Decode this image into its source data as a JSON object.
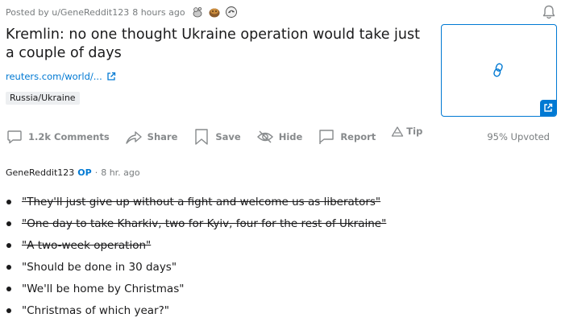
{
  "post": {
    "posted_by": "Posted by u/GeneReddit123",
    "time": "8 hours ago",
    "awards": [
      "wholesome-seal-award",
      "helpful-award",
      "take-my-energy-award"
    ],
    "title": "Kremlin: no one thought Ukraine operation would take just a couple of days",
    "link": "reuters.com/world/...",
    "flair": "Russia/Ukraine"
  },
  "actions": {
    "comments": "1.2k Comments",
    "share": "Share",
    "save": "Save",
    "hide": "Hide",
    "report": "Report",
    "tip": "Tip"
  },
  "upvoted": "95% Upvoted",
  "comment": {
    "author": "GeneReddit123",
    "op": "OP",
    "separator": "·",
    "time": "8 hr. ago",
    "items": [
      {
        "text": "\"They'll just give up without a fight and welcome us as liberators\"",
        "struck": true
      },
      {
        "text": "\"One day to take Kharkiv, two for Kyiv, four for the rest of Ukraine\"",
        "struck": true
      },
      {
        "text": "\"A two-week operation\"",
        "struck": true
      },
      {
        "text": "\"Should be done in 30 days\"",
        "struck": false
      },
      {
        "text": "\"We'll be home by Christmas\"",
        "struck": false
      },
      {
        "text": "\"Christmas of which year?\"",
        "struck": false
      }
    ]
  },
  "colors": {
    "accent": "#0079d3",
    "muted": "#878a8c",
    "text": "#1a1a1b",
    "flair_bg": "#edeff1"
  },
  "icons": {
    "notify": "bell-icon",
    "link": "external-link-icon",
    "thumbnail": "chain-link-icon"
  }
}
